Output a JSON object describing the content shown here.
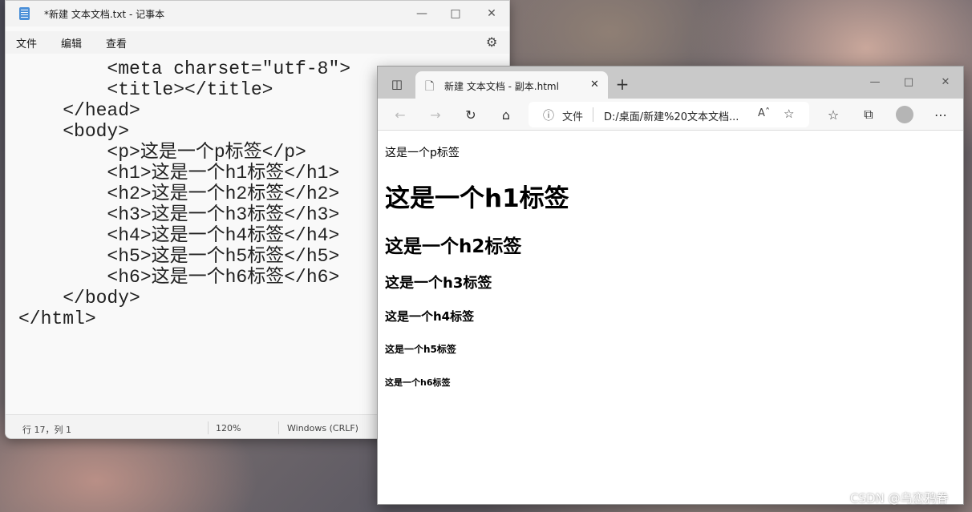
{
  "notepad": {
    "title": "*新建 文本文档.txt - 记事本",
    "menu": [
      "文件",
      "编辑",
      "查看"
    ],
    "lines": [
      "        <meta charset=\"utf-8\">",
      "        <title></title>",
      "    </head>",
      "    <body>",
      "        <p>这是一个p标签</p>",
      "        <h1>这是一个h1标签</h1>",
      "        <h2>这是一个h2标签</h2>",
      "        <h3>这是一个h3标签</h3>",
      "        <h4>这是一个h4标签</h4>",
      "        <h5>这是一个h5标签</h5>",
      "        <h6>这是一个h6标签</h6>",
      "    </body>",
      "</html>"
    ],
    "status": {
      "position": "行 17，列 1",
      "zoom": "120%",
      "eol": "Windows (CRLF)"
    }
  },
  "browser": {
    "tab_title": "新建 文本文档 - 副本.html",
    "address_label": "文件",
    "address_url": "D:/桌面/新建%20文本文档...",
    "page": {
      "p": "这是一个p标签",
      "h1": "这是一个h1标签",
      "h2": "这是一个h2标签",
      "h3": "这是一个h3标签",
      "h4": "这是一个h4标签",
      "h5": "这是一个h5标签",
      "h6": "这是一个h6标签"
    }
  },
  "watermark": "CSDN @乌恋鸦眷"
}
